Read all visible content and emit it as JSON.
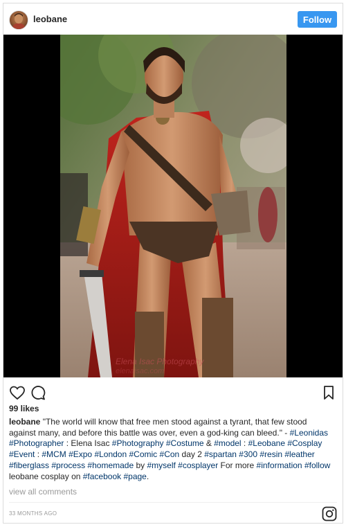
{
  "post": {
    "username": "leobane",
    "follow_label": "Follow",
    "likes": "99 likes",
    "caption": {
      "username": "leobane",
      "segments": [
        {
          "text": " \"The world will know that free men stood against a tyrant, that few stood against many, and before this battle was over, even a god-king can bleed.\" - ",
          "tag": false
        },
        {
          "text": "#Leonidas",
          "tag": true
        },
        {
          "text": " ",
          "tag": false
        },
        {
          "text": "#Photographer",
          "tag": true
        },
        {
          "text": " : Elena Isac ",
          "tag": false
        },
        {
          "text": "#Photography",
          "tag": true
        },
        {
          "text": " ",
          "tag": false
        },
        {
          "text": "#Costume",
          "tag": true
        },
        {
          "text": " & ",
          "tag": false
        },
        {
          "text": "#model",
          "tag": true
        },
        {
          "text": " : ",
          "tag": false
        },
        {
          "text": "#Leobane",
          "tag": true
        },
        {
          "text": " ",
          "tag": false
        },
        {
          "text": "#Cosplay",
          "tag": true
        },
        {
          "text": " ",
          "tag": false
        },
        {
          "text": "#Event",
          "tag": true
        },
        {
          "text": " : ",
          "tag": false
        },
        {
          "text": "#MCM",
          "tag": true
        },
        {
          "text": " ",
          "tag": false
        },
        {
          "text": "#Expo",
          "tag": true
        },
        {
          "text": " ",
          "tag": false
        },
        {
          "text": "#London",
          "tag": true
        },
        {
          "text": " ",
          "tag": false
        },
        {
          "text": "#Comic",
          "tag": true
        },
        {
          "text": " ",
          "tag": false
        },
        {
          "text": "#Con",
          "tag": true
        },
        {
          "text": " day 2 ",
          "tag": false
        },
        {
          "text": "#spartan",
          "tag": true
        },
        {
          "text": " ",
          "tag": false
        },
        {
          "text": "#300",
          "tag": true
        },
        {
          "text": " ",
          "tag": false
        },
        {
          "text": "#resin",
          "tag": true
        },
        {
          "text": " ",
          "tag": false
        },
        {
          "text": "#leather",
          "tag": true
        },
        {
          "text": " ",
          "tag": false
        },
        {
          "text": "#fiberglass",
          "tag": true
        },
        {
          "text": " ",
          "tag": false
        },
        {
          "text": "#process",
          "tag": true
        },
        {
          "text": " ",
          "tag": false
        },
        {
          "text": "#homemade",
          "tag": true
        },
        {
          "text": " by ",
          "tag": false
        },
        {
          "text": "#myself",
          "tag": true
        },
        {
          "text": " ",
          "tag": false
        },
        {
          "text": "#cosplayer",
          "tag": true
        },
        {
          "text": " For more ",
          "tag": false
        },
        {
          "text": "#information",
          "tag": true
        },
        {
          "text": " ",
          "tag": false
        },
        {
          "text": "#follow",
          "tag": true
        },
        {
          "text": " leobane cosplay on ",
          "tag": false
        },
        {
          "text": "#facebook",
          "tag": true
        },
        {
          "text": " ",
          "tag": false
        },
        {
          "text": "#page",
          "tag": true
        },
        {
          "text": ".",
          "tag": false
        }
      ]
    },
    "view_comments": "view all comments",
    "timestamp": "33 MONTHS AGO",
    "watermark": "Elena Isac Photography",
    "watermark_sub": "elenaisac.com"
  },
  "icons": {
    "like": "heart-icon",
    "comment": "comment-icon",
    "save": "bookmark-icon",
    "instagram": "instagram-logo-icon"
  },
  "colors": {
    "follow_button": "#3897f0",
    "hashtag": "#003569",
    "muted": "#999999"
  }
}
